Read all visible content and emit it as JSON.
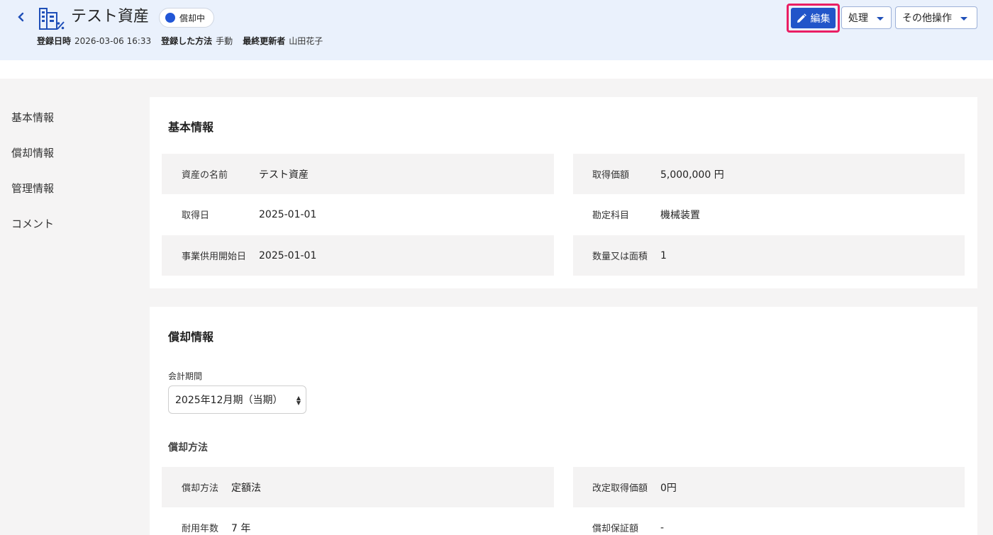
{
  "header": {
    "title": "テスト資産",
    "status": "償却中",
    "meta": [
      {
        "label": "登録日時",
        "value": "2026-03-06 16:33"
      },
      {
        "label": "登録した方法",
        "value": "手動"
      },
      {
        "label": "最終更新者",
        "value": "山田花子"
      }
    ],
    "buttons": {
      "edit": "編集",
      "process": "処理",
      "other": "その他操作"
    }
  },
  "sidenav": [
    "基本情報",
    "償却情報",
    "管理情報",
    "コメント"
  ],
  "basic": {
    "title": "基本情報",
    "rows": [
      {
        "label": "資産の名前",
        "value": "テスト資産"
      },
      {
        "label": "取得価額",
        "value": "5,000,000 円"
      },
      {
        "label": "取得日",
        "value": "2025-01-01"
      },
      {
        "label": "勘定科目",
        "value": "機械装置"
      },
      {
        "label": "事業供用開始日",
        "value": "2025-01-01"
      },
      {
        "label": "数量又は面積",
        "value": "1"
      }
    ]
  },
  "depreciation": {
    "title": "償却情報",
    "period_label": "会計期間",
    "period_value": "2025年12月期（当期）",
    "method_title": "償却方法",
    "rows": [
      {
        "label": "償却方法",
        "value": "定額法"
      },
      {
        "label": "改定取得価額",
        "value": "0円"
      },
      {
        "label": "耐用年数",
        "value": "7 年"
      },
      {
        "label": "償却保証額",
        "value": "-"
      }
    ]
  },
  "colors": {
    "accent": "#2155c9",
    "highlight": "#ea1e63",
    "header_bg": "#eaf1fc"
  }
}
